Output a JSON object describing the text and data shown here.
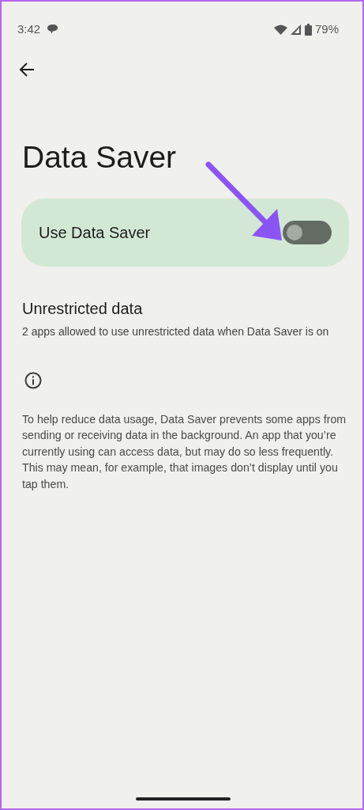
{
  "status_bar": {
    "time": "3:42",
    "battery": "79%"
  },
  "title": "Data Saver",
  "main_switch": {
    "label": "Use Data Saver",
    "checked": false
  },
  "unrestricted": {
    "title": "Unrestricted data",
    "summary": "2 apps allowed to use unrestricted data when Data Saver is on"
  },
  "footer": {
    "text": "To help reduce data usage, Data Saver prevents some apps from sending or receiving data in the background. An app that you’re currently using can access data, but may do so less frequently. This may mean, for example, that images don’t display until you tap them."
  }
}
